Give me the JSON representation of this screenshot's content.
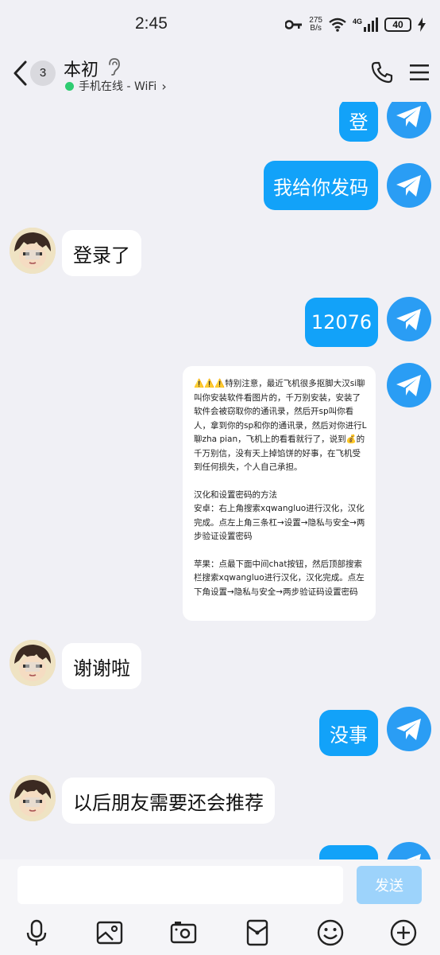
{
  "status_bar": {
    "time": "2:45",
    "net_speed_value": "275",
    "net_speed_unit": "B/s",
    "signal_label": "4G",
    "battery": "40"
  },
  "header": {
    "unread_count": "3",
    "contact_name": "本初",
    "online_status": "手机在线 - WiFi",
    "online_chevron": "›"
  },
  "messages": {
    "m1": "登",
    "m2": "我给你发码",
    "m3": "登录了",
    "m4": "12076",
    "card": {
      "p1": "⚠️⚠️⚠️特别注意，最近飞机很多抠脚大汉si聊叫你安装软件看图片的，千万别安装，安装了软件会被窃取你的通讯录，然后开sp叫你看人，拿到你的sp和你的通讯录，然后对你进行L聊zha pian，飞机上的看看就行了，说到💰的千万别信，没有天上掉馅饼的好事，在飞机受到任何损失，个人自己承担。",
      "p2": "汉化和设置密码的方法\n安卓：右上角搜索xqwangluo进行汉化，汉化完成。点左上角三条杠→设置→隐私与安全→两步验证设置密码",
      "p3": "苹果：点最下面中间chat按钮，然后顶部搜索栏搜索xqwangluo进行汉化，汉化完成。点左下角设置→隐私与安全→两步验证码设置密码"
    },
    "m5": "谢谢啦",
    "m6": "没事",
    "m7": "以后朋友需要还会推荐"
  },
  "input": {
    "value": "",
    "send_label": "发送"
  },
  "toolbar_icons": [
    "microphone-icon",
    "image-icon",
    "camera-icon",
    "red-packet-icon",
    "emoji-icon",
    "plus-icon"
  ],
  "colors": {
    "outgoing_bubble": "#12a2f9",
    "send_button_disabled": "#9dd3fb",
    "online_dot": "#2ecc71",
    "background": "#f0f0f5"
  }
}
